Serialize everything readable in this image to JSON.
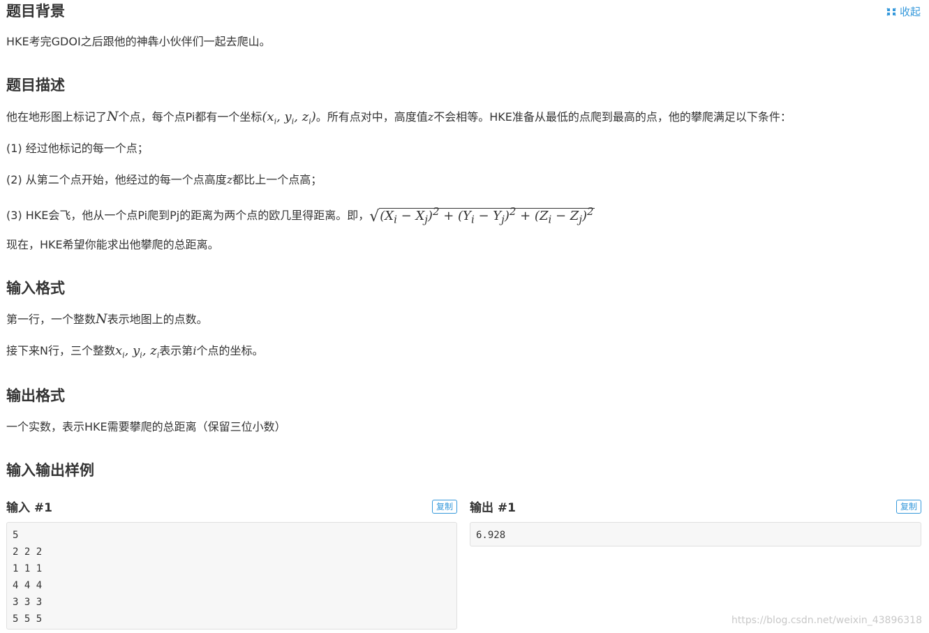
{
  "collapse_label": "收起",
  "background": {
    "title": "题目背景",
    "text": "HKE考完GDOI之后跟他的神犇小伙伴们一起去爬山。"
  },
  "description": {
    "title": "题目描述",
    "line1_a": "他在地形图上标记了",
    "line1_N": "N",
    "line1_b": "个点，每个点Pi都有一个坐标",
    "line1_coord": "(x",
    "line1_c": "。所有点对中，高度值",
    "line1_z": "z",
    "line1_d": "不会相等。HKE准备从最低的点爬到最高的点，他的攀爬满足以下条件：",
    "cond1": "(1) 经过他标记的每一个点；",
    "cond2_a": "(2) 从第二个点开始，他经过的每一个点高度",
    "cond2_z": "z",
    "cond2_b": "都比上一个点高；",
    "cond3": "(3) HKE会飞，他从一个点Pi爬到Pj的距离为两个点的欧几里得距离。即，",
    "now": "现在，HKE希望你能求出他攀爬的总距离。"
  },
  "input_format": {
    "title": "输入格式",
    "line1_a": "第一行，一个整数",
    "line1_N": "N",
    "line1_b": "表示地图上的点数。",
    "line2_a": "接下来N行，三个整数",
    "line2_b": "表示第",
    "line2_i": "i",
    "line2_c": "个点的坐标。"
  },
  "output_format": {
    "title": "输出格式",
    "text": "一个实数，表示HKE需要攀爬的总距离（保留三位小数）"
  },
  "samples": {
    "title": "输入输出样例",
    "input_title": "输入 #1",
    "output_title": "输出 #1",
    "copy_label": "复制",
    "input_text": "5\n2 2 2\n1 1 1\n4 4 4\n3 3 3\n5 5 5",
    "output_text": "6.928"
  },
  "watermark": "https://blog.csdn.net/weixin_43896318"
}
